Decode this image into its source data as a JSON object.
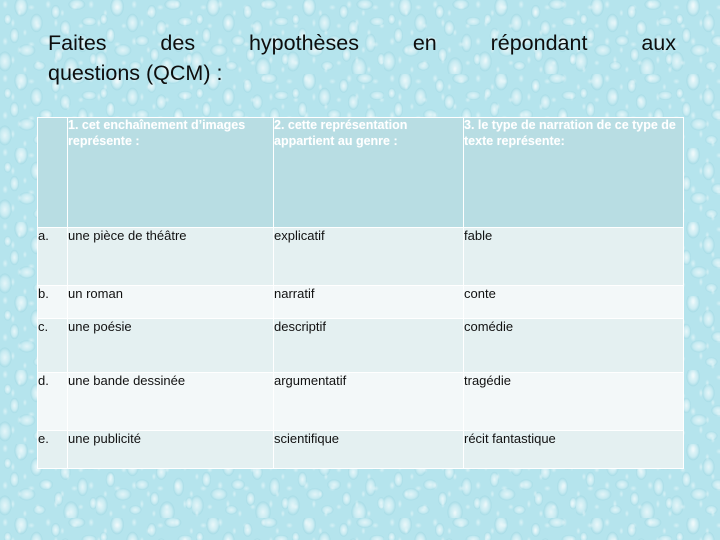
{
  "slide": {
    "background_color": "#b5e4ed",
    "background_texture": "water-droplets",
    "title_line1": "Faites des hypothèses en répondant aux",
    "title_line2": "questions (QCM) :"
  },
  "table": {
    "header_bg": "#b8dde3",
    "header_text_color": "#ffffff",
    "row_alt_bg": "#e4f0f1",
    "row_base_bg": "#f3f8f9",
    "border_color": "#ffffff",
    "headers": {
      "letter": "",
      "col1": "1. cet enchaînement d’images représente :",
      "col2": "2. cette représentation appartient au genre :",
      "col3": "3. le type de narration de ce type de texte représente:"
    },
    "rows": [
      {
        "letter": "a.",
        "col1": "une pièce de théâtre",
        "col2": "explicatif",
        "col3": "fable"
      },
      {
        "letter": "b.",
        "col1": "un roman",
        "col2": "narratif",
        "col3": "conte"
      },
      {
        "letter": "c.",
        "col1": "une poésie",
        "col2": "descriptif",
        "col3": "comédie"
      },
      {
        "letter": "d.",
        "col1": "une bande dessinée",
        "col2": "argumentatif",
        "col3": "tragédie"
      },
      {
        "letter": "e.",
        "col1": "une publicité",
        "col2": "scientifique",
        "col3": "récit fantastique"
      }
    ]
  }
}
